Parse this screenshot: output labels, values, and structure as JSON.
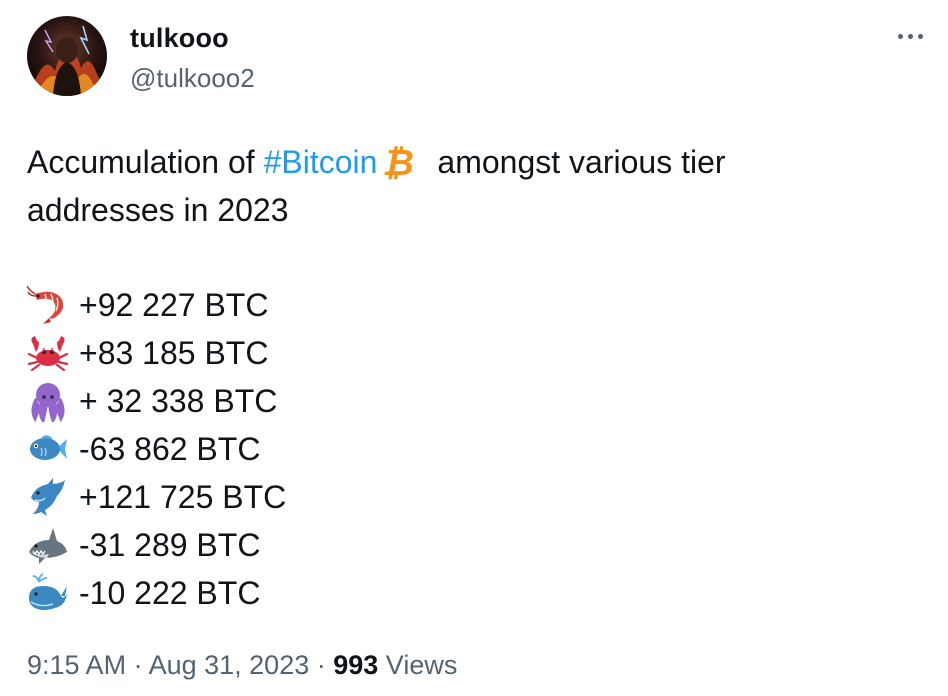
{
  "author": {
    "display_name": "tulkooo",
    "handle": "@tulkooo2"
  },
  "tweet": {
    "text_before_hashtag": "Accumulation of ",
    "hashtag": "#Bitcoin",
    "text_after_hashtag": "amongst various tier",
    "text_line2": "addresses in 2023",
    "rows": [
      {
        "icon": "shrimp-icon",
        "value": "+92 227 BTC"
      },
      {
        "icon": "crab-icon",
        "value": "+83 185 BTC"
      },
      {
        "icon": "octopus-icon",
        "value": "+ 32 338 BTC"
      },
      {
        "icon": "fish-icon",
        "value": "-63 862 BTC"
      },
      {
        "icon": "dolphin-icon",
        "value": "+121 725 BTC"
      },
      {
        "icon": "shark-icon",
        "value": "-31 289 BTC"
      },
      {
        "icon": "whale-icon",
        "value": "-10 222 BTC"
      }
    ]
  },
  "meta": {
    "time": "9:15 AM",
    "separator1": " · ",
    "date": "Aug 31, 2023",
    "separator2": " · ",
    "views_count": "993",
    "views_label": " Views"
  },
  "colors": {
    "hashtag": "#1d9bf0",
    "muted": "#536471",
    "text": "#0f1419",
    "bitcoin_orange": "#f7931a"
  }
}
